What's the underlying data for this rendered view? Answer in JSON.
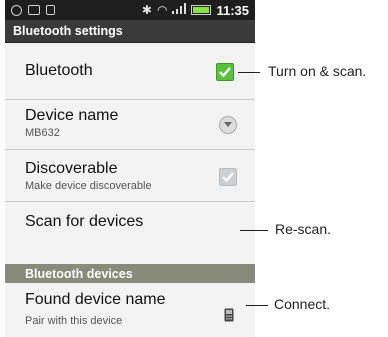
{
  "statusbar": {
    "time": "11:35"
  },
  "header": {
    "title": "Bluetooth settings"
  },
  "settings": [
    {
      "title": "Bluetooth",
      "subtitle": "",
      "control": "checkbox-checked"
    },
    {
      "title": "Device name",
      "subtitle": "MB632",
      "control": "dropdown"
    },
    {
      "title": "Discoverable",
      "subtitle": "Make device discoverable",
      "control": "checkbox-disabled"
    },
    {
      "title": "Scan for devices",
      "subtitle": "",
      "control": "none"
    }
  ],
  "section": {
    "title": "Bluetooth devices"
  },
  "devices": [
    {
      "title": "Found device name",
      "subtitle": "Pair with this device",
      "icon": "phone-icon"
    }
  ],
  "callouts": {
    "bluetooth": "Turn on & scan.",
    "scan": "Re-scan.",
    "device": "Connect."
  },
  "colors": {
    "checked": "#59c13b",
    "section_bar": "#888a7a",
    "title_bar": "#3a3a3a"
  }
}
